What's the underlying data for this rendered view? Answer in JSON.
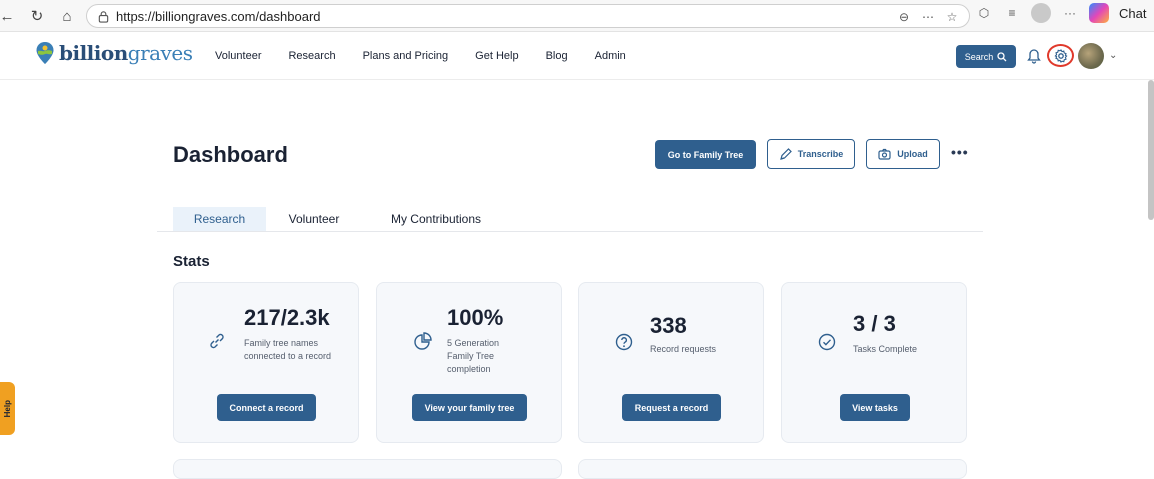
{
  "browser": {
    "url": "https://billiongraves.com/dashboard",
    "chat_label": "Chat"
  },
  "header": {
    "logo_main": "billion",
    "logo_accent": "graves",
    "nav": [
      "Volunteer",
      "Research",
      "Plans and Pricing",
      "Get Help",
      "Blog",
      "Admin"
    ],
    "search_label": "Search"
  },
  "dashboard": {
    "title": "Dashboard",
    "go_family_tree": "Go to Family Tree",
    "transcribe": "Transcribe",
    "upload": "Upload",
    "more": "•••"
  },
  "tabs": [
    "Research",
    "Volunteer",
    "My Contributions"
  ],
  "stats": {
    "title": "Stats",
    "cards": [
      {
        "value": "217/2.3k",
        "desc": "Family tree names connected to a record",
        "button": "Connect a record",
        "icon": "link-icon"
      },
      {
        "value": "100%",
        "desc": "5 Generation Family Tree completion",
        "button": "View your family tree",
        "icon": "pie-chart-icon"
      },
      {
        "value": "338",
        "desc": "Record requests",
        "button": "Request a record",
        "icon": "question-icon"
      },
      {
        "value": "3 / 3",
        "desc": "Tasks Complete",
        "button": "View tasks",
        "icon": "check-circle-icon"
      }
    ]
  },
  "help_tab": "Help",
  "colors": {
    "brand": "#2f5f8e",
    "help": "#f0a021",
    "highlight": "#e0392b"
  }
}
